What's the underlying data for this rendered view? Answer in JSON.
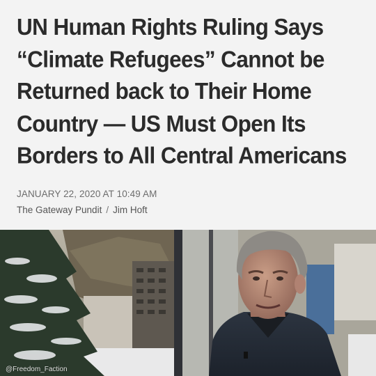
{
  "article": {
    "headline": "UN Human Rights Ruling Says “Climate Refugees” Cannot be Returned back to Their Home Country — US Must Open Its Borders to All Central Americans",
    "date": "JANUARY 22, 2020 AT 10:49 AM",
    "source": "The Gateway Pundit",
    "separator": "/",
    "author": "Jim Hoft"
  },
  "photo": {
    "watermark": "@Freedom_Faction"
  }
}
